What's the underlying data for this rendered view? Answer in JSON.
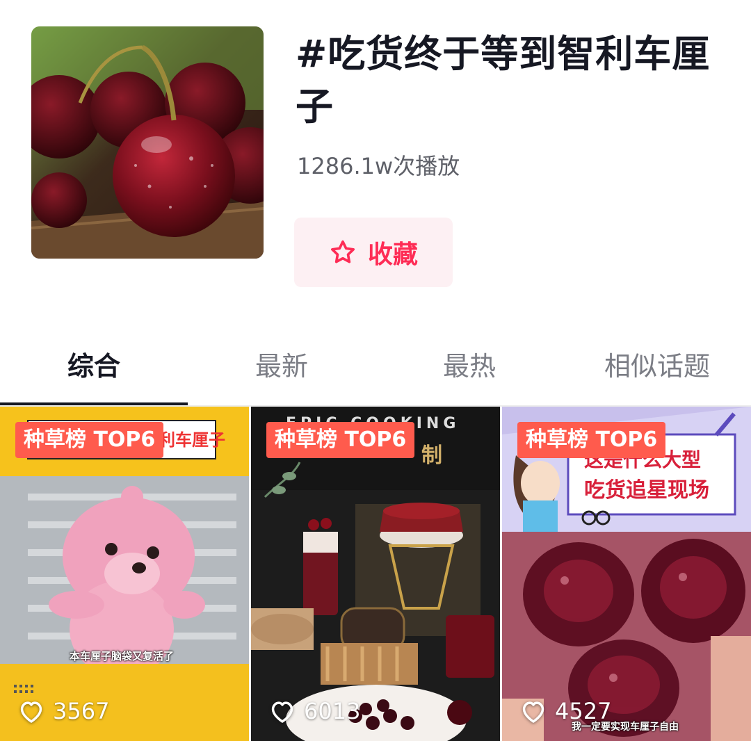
{
  "topic": {
    "title": "#吃货终于等到智利车厘子",
    "play_count": "1286.1w次播放",
    "favorite_label": "收藏"
  },
  "tabs": [
    {
      "label": "综合",
      "active": true
    },
    {
      "label": "最新",
      "active": false
    },
    {
      "label": "最热",
      "active": false
    },
    {
      "label": "相似话题",
      "active": false
    }
  ],
  "videos": [
    {
      "badge": "种草榜 TOP6",
      "likes": "3567",
      "overlay": "利车厘子",
      "caption": "本车厘子脑袋又复活了"
    },
    {
      "badge": "种草榜 TOP6",
      "likes": "6013",
      "overlay": "EPIC COOKING",
      "overlay2": "制"
    },
    {
      "badge": "种草榜 TOP6",
      "likes": "4527",
      "overlay": "这是什么大型",
      "overlay2": "吃货追星现场",
      "caption": "我一定要实现车厘子自由"
    }
  ],
  "colors": {
    "accent": "#fe2c55",
    "fav_bg": "#fdf0f3",
    "badge_bg": "#ff5b4d",
    "text_primary": "#161823",
    "text_secondary": "#7b7d85"
  },
  "icons": {
    "favorite": "star-outline-icon",
    "likes": "heart-outline-icon"
  }
}
